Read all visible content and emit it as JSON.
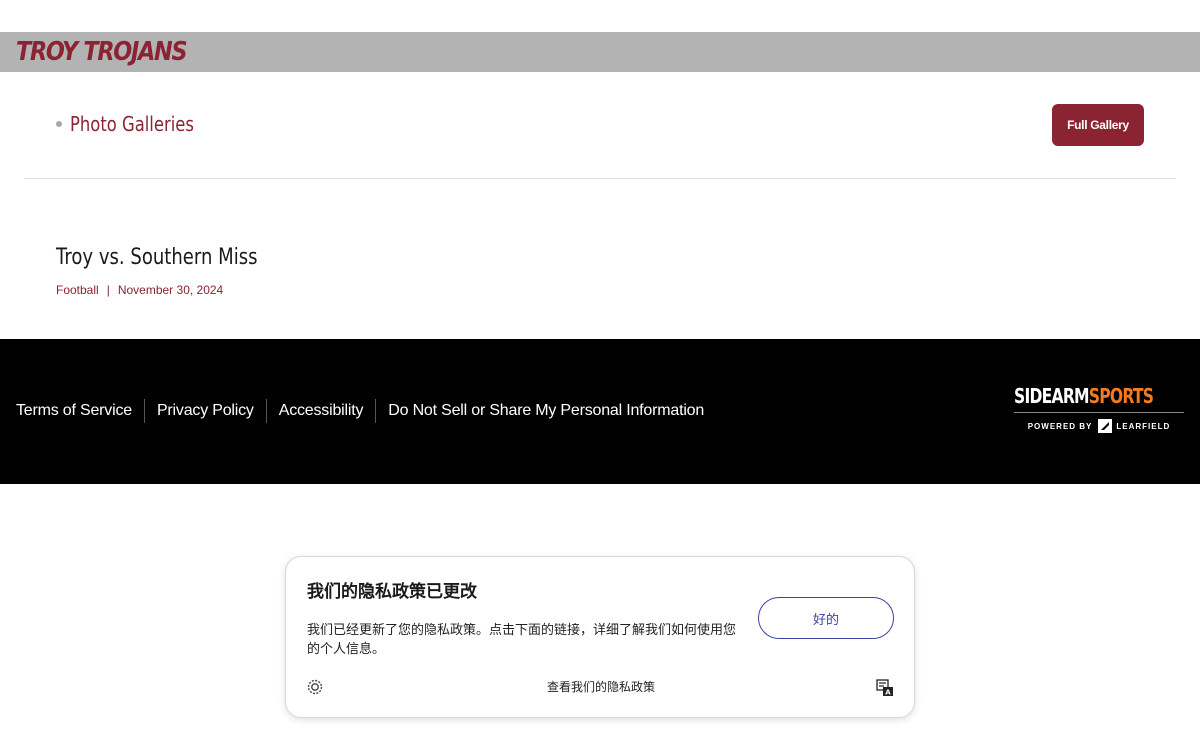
{
  "header": {
    "brand": "TROY TROJANS"
  },
  "section": {
    "title": "Photo Galleries",
    "full_gallery_label": "Full Gallery"
  },
  "gallery": {
    "title": "Troy vs. Southern Miss",
    "sport": "Football",
    "separator": "|",
    "date": "November 30, 2024"
  },
  "footer": {
    "links": [
      {
        "label": "Terms of Service"
      },
      {
        "label": "Privacy Policy"
      },
      {
        "label": "Accessibility"
      },
      {
        "label": "Do Not Sell or Share My Personal Information"
      }
    ],
    "logo": {
      "part1": "SIDEARM",
      "part2": "SPORTS",
      "powered_by": "POWERED BY",
      "partner": "LEARFIELD"
    }
  },
  "privacy_popup": {
    "title": "我们的隐私政策已更改",
    "body": "我们已经更新了您的隐私政策。点击下面的链接，详细了解我们如何使用您的个人信息。",
    "ok_label": "好的",
    "link_label": "查看我们的隐私政策"
  },
  "colors": {
    "brand": "#8a2432",
    "topbar": "#b3b3b3",
    "footer": "#000000",
    "sidearm_orange": "#f47a20",
    "ok_blue": "#3b3fa8"
  }
}
